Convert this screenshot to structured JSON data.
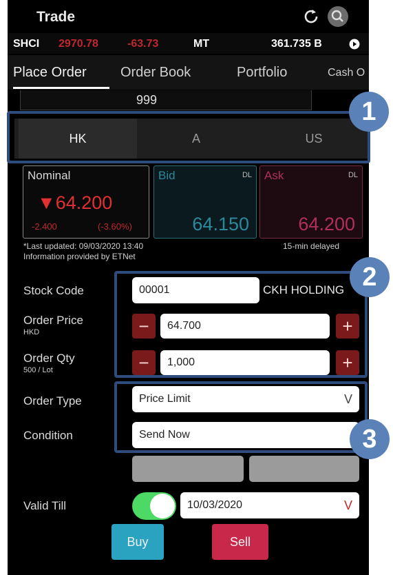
{
  "header": {
    "title": "Trade"
  },
  "ticker": {
    "symbol": "SHCI",
    "index": "2970.78",
    "change": "-63.73",
    "market": "MT",
    "turnover": "361.735 B"
  },
  "tabs": [
    {
      "label": "Place Order"
    },
    {
      "label": "Order Book"
    },
    {
      "label": "Portfolio"
    },
    {
      "label": "Cash O"
    }
  ],
  "code_bar": {
    "value": "999"
  },
  "markets": [
    {
      "label": "HK"
    },
    {
      "label": "A"
    },
    {
      "label": "US"
    }
  ],
  "quote": {
    "nominal_label": "Nominal",
    "nominal_value": "▼64.200",
    "nominal_change": "-2.400",
    "nominal_pct": "(-3.60%)",
    "bid_label": "Bid",
    "bid_dl": "DL",
    "bid_value": "64.150",
    "ask_label": "Ask",
    "ask_dl": "DL",
    "ask_value": "64.200"
  },
  "info": {
    "last_updated": "*Last updated: 09/03/2020 13:40",
    "provider": "Information provided by ETNet",
    "delay": "15-min delayed"
  },
  "form": {
    "stock_code_label": "Stock Code",
    "stock_code_value": "00001",
    "stock_name": "CKH HOLDING",
    "order_price_label": "Order Price",
    "order_price_unit": "HKD",
    "order_price_value": "64.700",
    "order_qty_label": "Order Qty",
    "order_qty_lot": "500 / Lot",
    "order_qty_value": "1,000",
    "order_type_label": "Order Type",
    "order_type_value": "Price Limit",
    "condition_label": "Condition",
    "condition_value": "Send Now",
    "valid_till_label": "Valid Till",
    "valid_till_value": "10/03/2020"
  },
  "actions": {
    "buy": "Buy",
    "sell": "Sell"
  },
  "callouts": [
    {
      "number": "1"
    },
    {
      "number": "2"
    },
    {
      "number": "3"
    }
  ],
  "colors": {
    "down_red": "#e03030",
    "bid_accent": "#2a8a9c",
    "ask_accent": "#b0305a",
    "buy_bg": "#2aa3c0",
    "sell_bg": "#c8284a",
    "toggle_on": "#4cd964",
    "callout": "#2f4d7c"
  }
}
